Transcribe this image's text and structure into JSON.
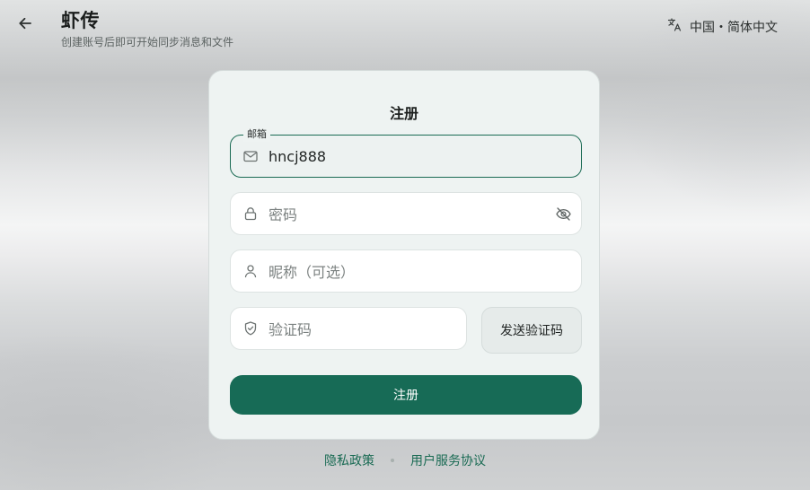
{
  "header": {
    "title": "虾传",
    "subtitle": "创建账号后即可开始同步消息和文件",
    "back_icon": "arrow-left-icon",
    "language": "中国・简体中文",
    "language_icon": "translate-icon"
  },
  "card": {
    "title": "注册",
    "email": {
      "label": "邮箱",
      "value": "hncj888",
      "icon": "mail-icon"
    },
    "password": {
      "placeholder": "密码",
      "icon": "lock-icon",
      "toggle_icon": "eye-off-icon"
    },
    "nickname": {
      "placeholder": "昵称（可选）",
      "icon": "user-icon"
    },
    "code": {
      "placeholder": "验证码",
      "icon": "shield-check-icon"
    },
    "send_code_label": "发送验证码",
    "submit_label": "注册"
  },
  "footer": {
    "privacy": "隐私政策",
    "terms": "用户服务协议"
  },
  "colors": {
    "accent": "#176b56",
    "card_bg": "#eef3f2",
    "link": "#1a6b54"
  }
}
